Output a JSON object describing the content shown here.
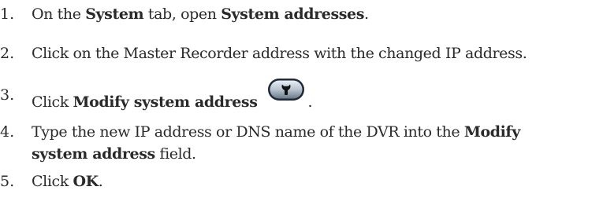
{
  "steps": [
    {
      "number": "1.",
      "parts": [
        "On the ",
        "System",
        " tab, open ",
        "System addresses",
        "."
      ]
    },
    {
      "number": "2.",
      "parts": [
        "Click on the Master Recorder address with the changed IP address."
      ]
    },
    {
      "number": "3.",
      "parts": [
        "Click ",
        "Modify system address",
        "."
      ],
      "icon": "wrench-icon"
    },
    {
      "number": "4.",
      "parts": [
        "Type the new IP address or DNS name of the DVR into the ",
        "Modify",
        "system address",
        " field."
      ]
    },
    {
      "number": "5.",
      "parts": [
        "Click ",
        "OK",
        "."
      ]
    }
  ]
}
